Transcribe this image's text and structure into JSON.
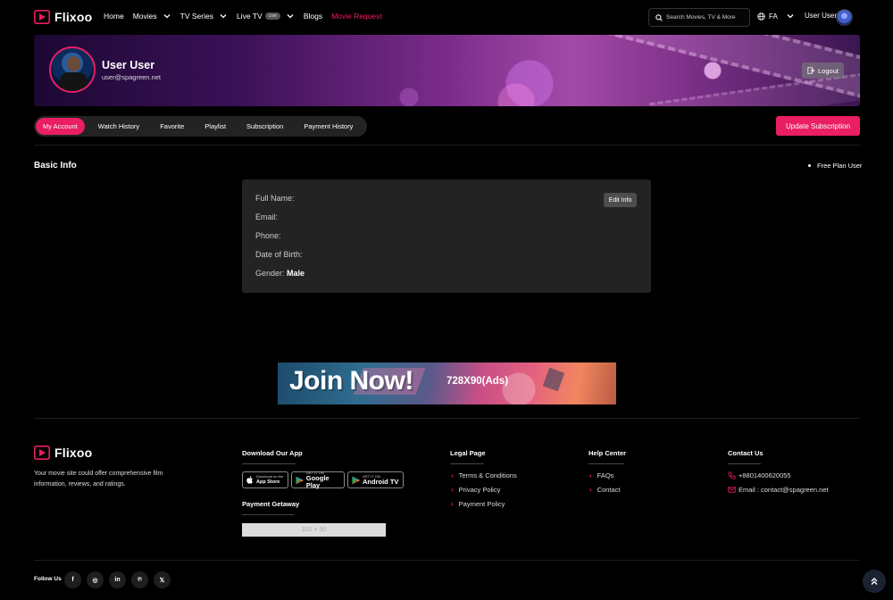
{
  "brand": {
    "name": "Flixoo",
    "accent": "#e91e63"
  },
  "nav": {
    "items": [
      {
        "label": "Home"
      },
      {
        "label": "Movies"
      },
      {
        "label": "TV Series"
      },
      {
        "label": "Live TV",
        "badge": "Live"
      },
      {
        "label": "Blogs"
      },
      {
        "label": "Movie Request"
      }
    ],
    "search_placeholder": "Search Movies, TV & More",
    "language": "FA",
    "user_label": "User User"
  },
  "profile": {
    "name": "User User",
    "email": "user@spagreen.net",
    "logout_label": "Logout"
  },
  "tabs": [
    "My Account",
    "Watch History",
    "Favorite",
    "Playlist",
    "Subscription",
    "Payment History"
  ],
  "update_subscription_label": "Update Subscription",
  "basic_info": {
    "title": "Basic Info",
    "plan": "Free Plan User",
    "edit_label": "Edit Info",
    "fields": [
      {
        "label": "Full Name:",
        "value": ""
      },
      {
        "label": "Email:",
        "value": ""
      },
      {
        "label": "Phone:",
        "value": ""
      },
      {
        "label": "Date of Birth:",
        "value": ""
      },
      {
        "label": "Gender:",
        "value": "Male"
      }
    ]
  },
  "ad": {
    "headline": "Join Now!",
    "size_text": "728X90(Ads)"
  },
  "footer": {
    "description": "Your movie site could offer comprehensive film information, reviews, and ratings.",
    "download_title": "Download Our App",
    "stores": [
      {
        "line1": "Download on the",
        "line2": "App Store",
        "icon": "apple-icon"
      },
      {
        "line1": "GET IT ON",
        "line2": "Google Play",
        "icon": "google-play-icon"
      },
      {
        "line1": "GET IT ON",
        "line2": "Android TV",
        "icon": "android-tv-icon"
      }
    ],
    "payment_title": "Payment Getaway",
    "payment_placeholder": "310 × 30",
    "legal_title": "Legal Page",
    "legal_links": [
      "Terms & Conditions",
      "Privacy Policy",
      "Payment Policy"
    ],
    "help_title": "Help Center",
    "help_links": [
      "FAQs",
      "Contact"
    ],
    "contact_title": "Contact Us",
    "phone": "+8801400620055",
    "email": "Email : contact@spagreen.net",
    "follow_label": "Follow Us",
    "socials": [
      {
        "icon": "facebook-icon",
        "glyph": "f"
      },
      {
        "icon": "instagram-icon",
        "glyph": "◎"
      },
      {
        "icon": "linkedin-icon",
        "glyph": "in"
      },
      {
        "icon": "pinterest-icon",
        "glyph": "℗"
      },
      {
        "icon": "x-icon",
        "glyph": "𝕏"
      }
    ]
  }
}
